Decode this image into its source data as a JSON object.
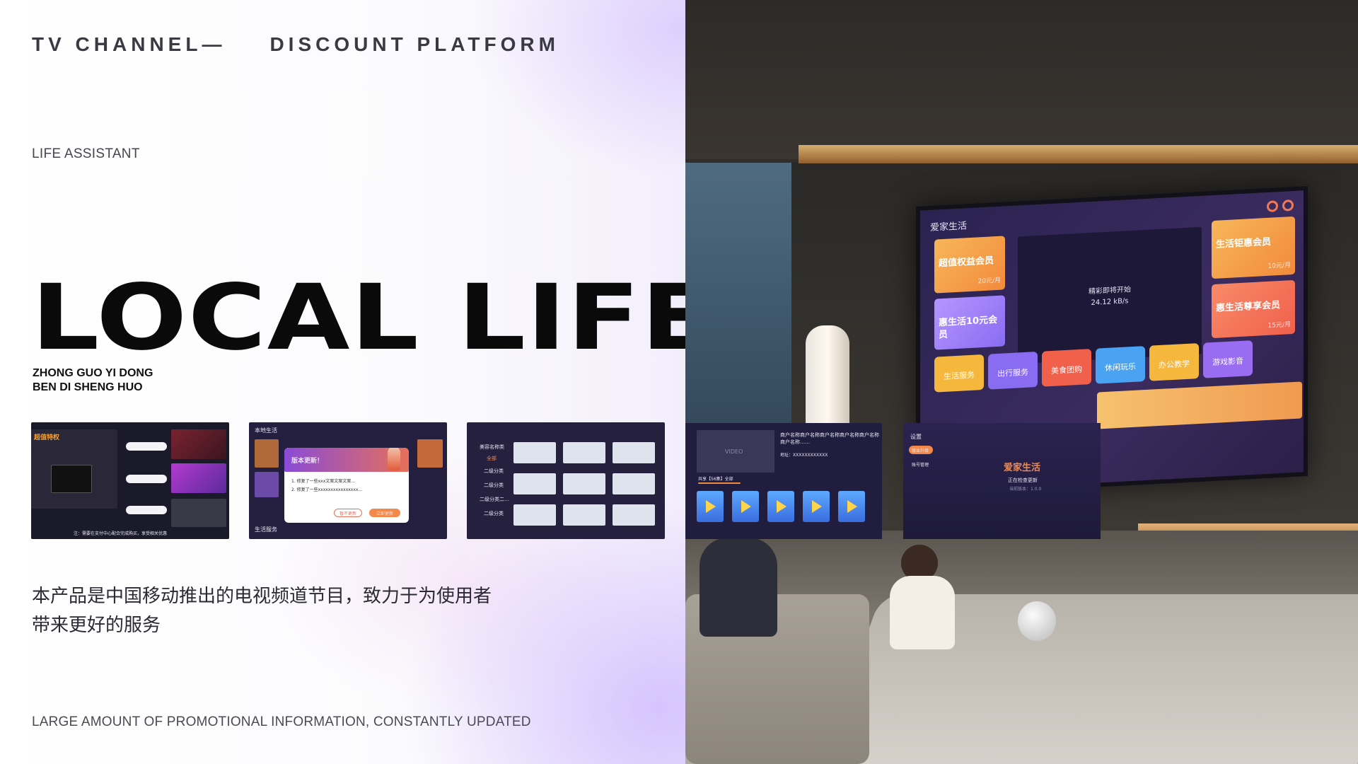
{
  "header": {
    "left": "TV CHANNEL—",
    "right": "DISCOUNT PLATFORM"
  },
  "sub_label": "LIFE ASSISTANT",
  "title": "LOCAL LIFE",
  "pinyin": {
    "line1": "ZHONG GUO YI DONG",
    "line2": "BEN DI SHENG HUO"
  },
  "description": "本产品是中国移动推出的电视频道节目，致力于为使用者带来更好的服务",
  "footer": "LARGE AMOUNT OF PROMOTIONAL INFORMATION, CONSTANTLY UPDATED",
  "thumb1": {
    "tag": "超值特权",
    "note": "注：需要在支付中心配合完成购买，享受相关优惠"
  },
  "thumb2": {
    "section_top": "本地生活",
    "dialog_title": "版本更新！",
    "dialog_body_1": "1. 修复了一些xxx文案文案文案…",
    "dialog_body_2": "2. 修复了一些xxxxxxxxxxxxxxxx…",
    "btn_later": "暂不更新",
    "btn_update": "立即更新",
    "section_bottom": "生活服务"
  },
  "thumb3": {
    "nav_title": "美容名称类",
    "nav_item_selected": "全部",
    "nav_items": [
      "二级分类",
      "二级分类",
      "二级分类二…",
      "二级分类"
    ]
  },
  "overlay1": {
    "video_label": "VIDEO",
    "title": "商户名称商户名称商户名称商户名称商户名称商户名称……",
    "meta": "地址：XXXXXXXXXXXX",
    "progress_label": "共享【56集】全部"
  },
  "overlay2": {
    "menu_title": "设置",
    "menu_item_active": "版本升级",
    "menu_item": "账号管理",
    "brand": "爱家生活",
    "status": "正在检查更新",
    "version": "当前版本：1.0.0"
  },
  "tv": {
    "title": "爱家生活",
    "card1": "超值权益会员",
    "card1_price": "20元/月",
    "card2": "惠生活10元会员",
    "card3": "生活钜惠会员",
    "card3_price": "10元/月",
    "card4": "惠生活尊享会员",
    "card4_price": "15元/月",
    "video_status": "精彩即将开始",
    "video_speed": "24.12 kB/s",
    "apps": [
      "生活服务",
      "出行服务",
      "美食团购",
      "休闲玩乐",
      "办公教学",
      "游戏影音"
    ]
  },
  "colors": {
    "accent_orange": "#f28a3c",
    "accent_purple": "#8a6cf2",
    "tv_bg": "#2a2352"
  }
}
